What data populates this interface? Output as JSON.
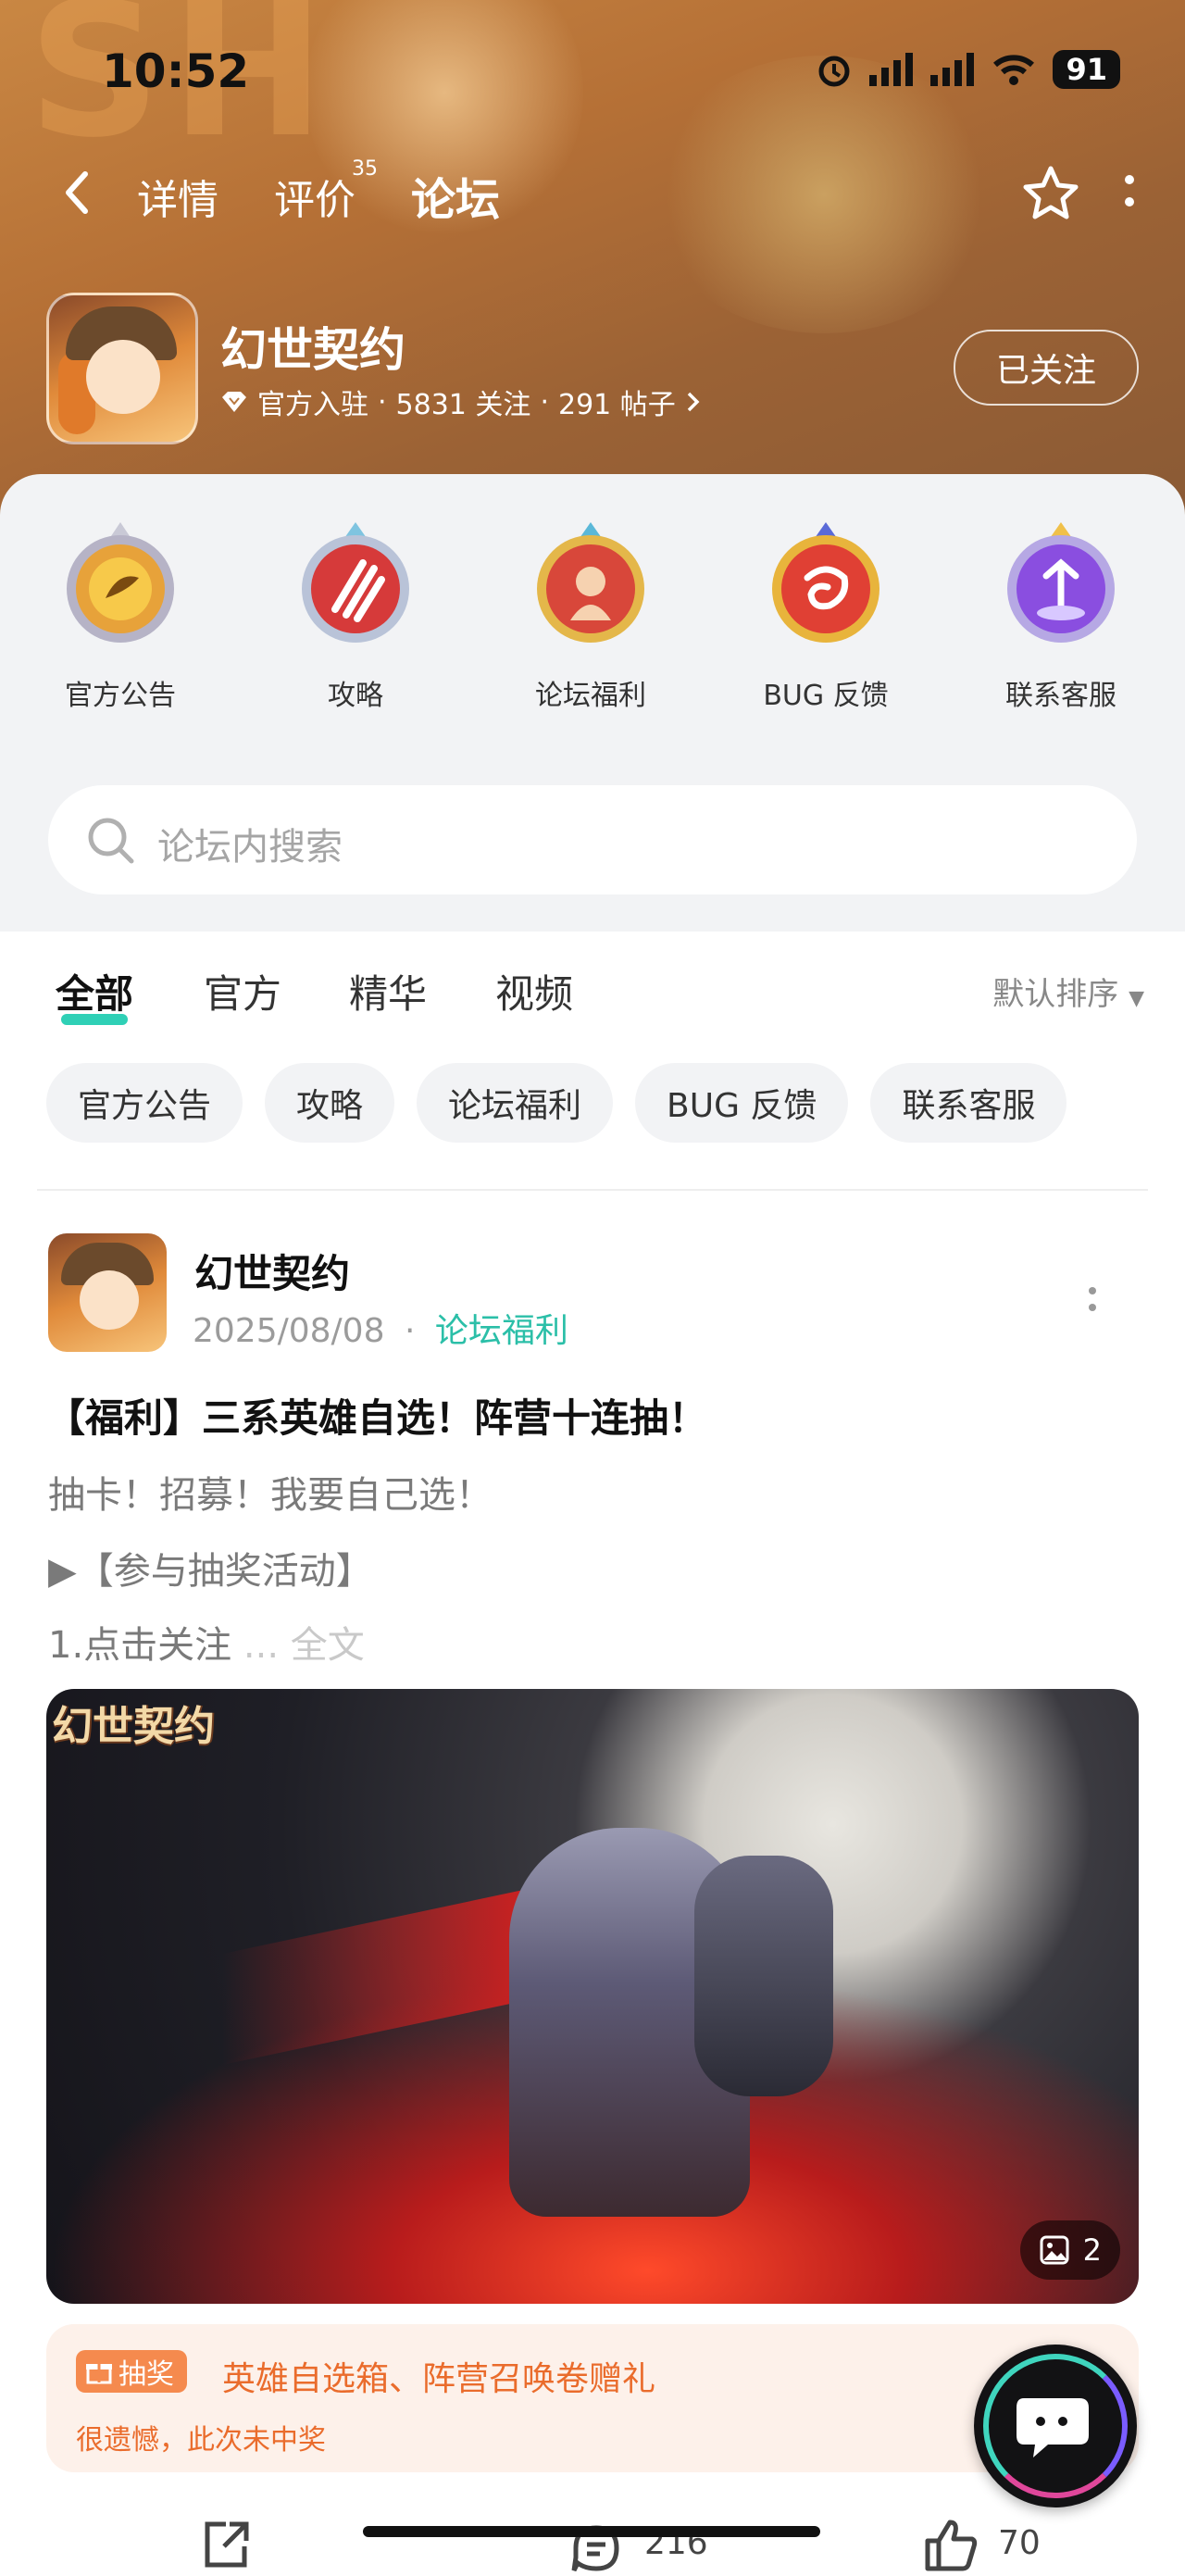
{
  "status_bar": {
    "time": "10:52",
    "battery": "91"
  },
  "nav": {
    "tabs": [
      {
        "label": "详情"
      },
      {
        "label": "评价"
      },
      {
        "label": "论坛"
      }
    ],
    "review_count": "35"
  },
  "game": {
    "name": "幻世契约",
    "verified": "官方入驻",
    "followers": "5831 关注",
    "posts": "291 帖子",
    "sep": "·",
    "follow_label": "已关注"
  },
  "categories": [
    {
      "label": "官方公告",
      "icon": "announcement-badge-icon",
      "color": "#e7a23a"
    },
    {
      "label": "攻略",
      "icon": "claw-badge-icon",
      "color": "#d63a3a"
    },
    {
      "label": "论坛福利",
      "icon": "gift-badge-icon",
      "color": "#d8473a"
    },
    {
      "label": "BUG 反馈",
      "icon": "bug-badge-icon",
      "color": "#e04034"
    },
    {
      "label": "联系客服",
      "icon": "service-badge-icon",
      "color": "#8a4ee0"
    }
  ],
  "search": {
    "placeholder": "论坛内搜索"
  },
  "feed_tabs": [
    {
      "label": "全部"
    },
    {
      "label": "官方"
    },
    {
      "label": "精华"
    },
    {
      "label": "视频"
    }
  ],
  "sort_label": "默认排序",
  "filter_chips": [
    {
      "label": "官方公告"
    },
    {
      "label": "攻略"
    },
    {
      "label": "论坛福利"
    },
    {
      "label": "BUG 反馈"
    },
    {
      "label": "联系客服"
    }
  ],
  "post": {
    "author": "幻世契约",
    "date": "2025/08/08",
    "dot": "·",
    "tag": "论坛福利",
    "title": "【福利】三系英雄自选！阵营十连抽！",
    "line1": "抽卡！招募！我要自己选！",
    "line2": "▶【参与抽奖活动】",
    "line3": "1.点击关注",
    "ellipsis": "...",
    "full_text": "全文",
    "image_logo": "幻世契约",
    "image_count": "2",
    "lottery_badge": "抽奖",
    "lottery_title": "英雄自选箱、阵营召唤卷赠礼",
    "lottery_result": "很遗憾，此次未中奖",
    "comments": "216",
    "likes": "70"
  },
  "colors": {
    "accent": "#2fd0b6",
    "tag": "#2bbfa8",
    "lottery": "#ea6c2c"
  }
}
